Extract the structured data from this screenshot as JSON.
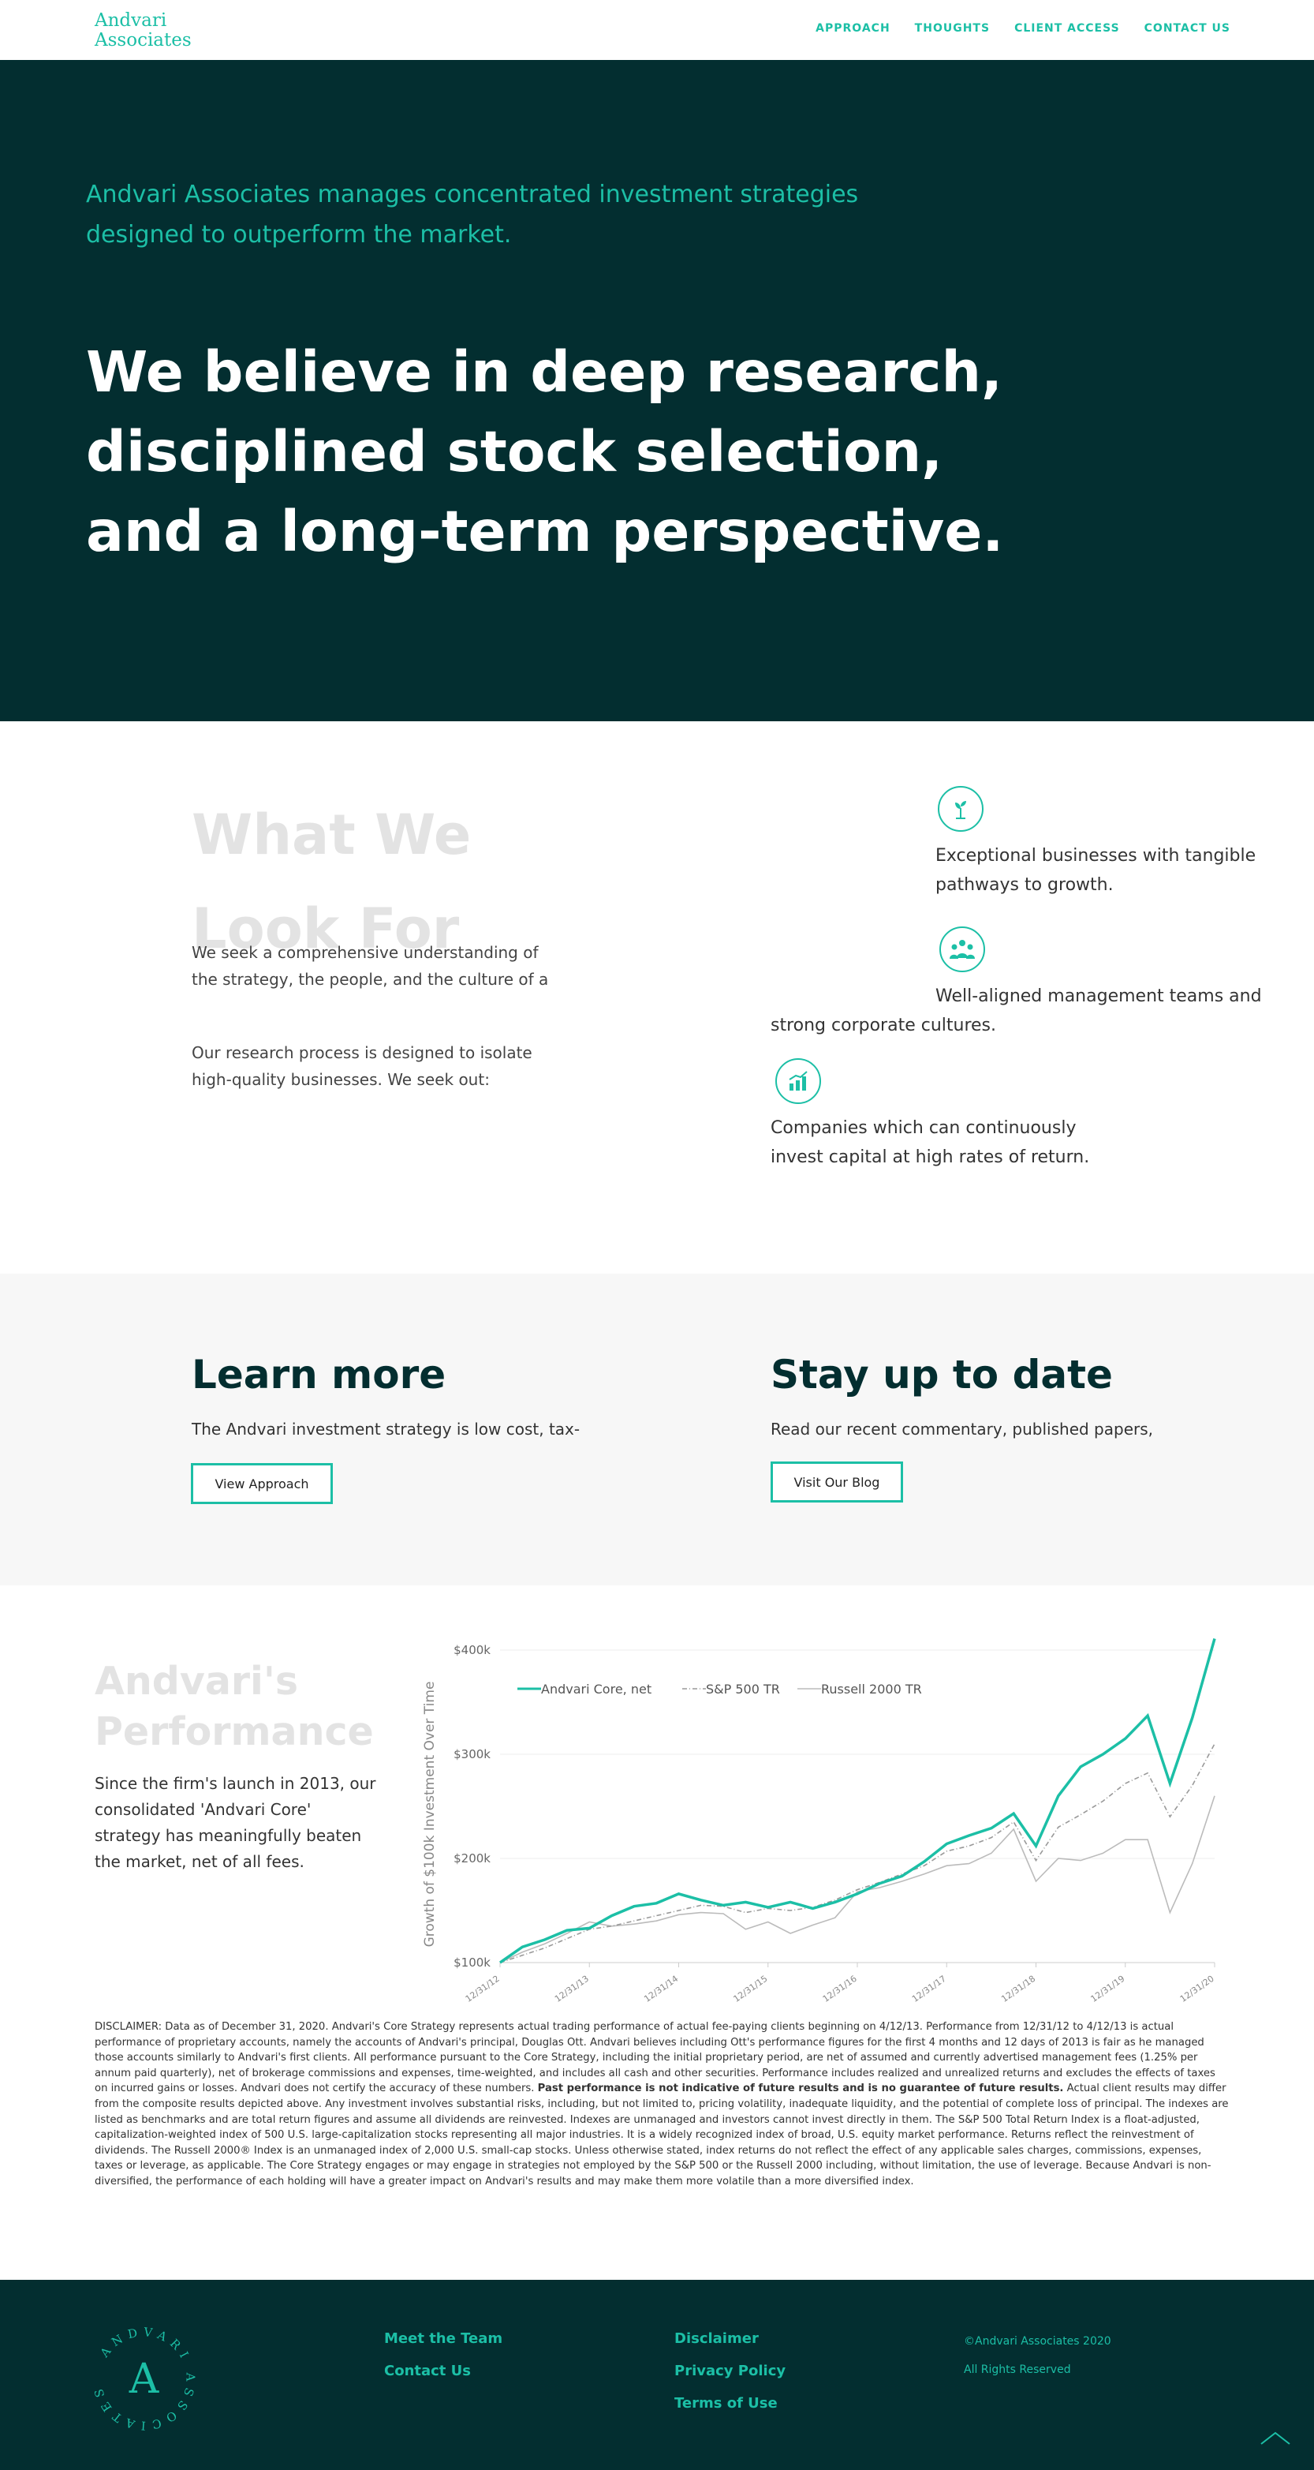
{
  "nav": {
    "logo_line1": "Andvari",
    "logo_line2": "Associates",
    "links": [
      "APPROACH",
      "THOUGHTS",
      "CLIENT ACCESS",
      "CONTACT US"
    ]
  },
  "hero": {
    "lead": "Andvari Associates manages concentrated investment strategies designed to outperform the market.",
    "title": "We believe in deep research, disciplined stock selection, and a long-term perspective."
  },
  "look": {
    "title_line1": "What We",
    "title_line2": "Look For",
    "p1": "We seek a comprehensive understanding of the strategy, the people, and the culture of a business before we invest a penny.",
    "p2": "Our research process is designed to isolate high-quality businesses. We seek out:",
    "features": [
      {
        "icon": "sprout-icon",
        "text": "Exceptional businesses with tangible pathways to growth."
      },
      {
        "icon": "team-icon",
        "text": "Well-aligned management teams and strong corporate cultures."
      },
      {
        "icon": "growth-chart-icon",
        "text": "Companies which can continuously invest capital at high rates of return."
      }
    ]
  },
  "cta": {
    "learn_title": "Learn more",
    "learn_text": "The Andvari investment strategy is low cost, tax-",
    "learn_button": "View Approach",
    "stay_title": "Stay up to date",
    "stay_text": "Read our recent commentary, published papers,",
    "stay_button": "Visit Our Blog"
  },
  "performance": {
    "title_line1": "Andvari's",
    "title_line2": "Performance",
    "text": "Since the firm's launch in 2013, our consolidated 'Andvari Core' strategy has meaningfully beaten the market, net of all fees.",
    "disclaimer_a": "DISCLAIMER: Data as of December 31, 2020. Andvari's Core Strategy represents actual trading performance of actual fee-paying clients beginning on 4/12/13. Performance from 12/31/12 to 4/12/13 is actual performance of proprietary accounts, namely the accounts of Andvari's principal, Douglas Ott. Andvari believes including Ott's performance figures for the first 4 months and 12 days of 2013 is fair as he managed those accounts similarly to Andvari's first clients. All performance pursuant to the Core Strategy, including the initial proprietary period, are net of assumed and currently advertised management fees (1.25% per annum paid quarterly), net of brokerage commissions and expenses, time-weighted, and includes all cash and other securities. Performance includes realized and unrealized returns and excludes the effects of taxes on incurred gains or losses. Andvari does not certify the accuracy of these numbers.",
    "disclaimer_bold": "Past performance is not indicative of future results and is no guarantee of future results.",
    "disclaimer_b": "Actual client results may differ from the composite results depicted above. Any investment involves substantial risks, including, but not limited to, pricing volatility, inadequate liquidity, and the potential of complete loss of principal. The indexes are listed as benchmarks and are total return figures and assume all dividends are reinvested. Indexes are unmanaged and investors cannot invest directly in them. The S&P 500 Total Return Index is a float-adjusted, capitalization-weighted index of 500 U.S. large-capitalization stocks representing all major industries. It is a widely recognized index of broad, U.S. equity market performance. Returns reflect the reinvestment of dividends. The Russell 2000® Index is an unmanaged index of 2,000 U.S. small-cap stocks. Unless otherwise stated, index returns do not reflect the effect of any applicable sales charges, commissions, expenses, taxes or leverage, as applicable. The Core Strategy engages or may engage in strategies not employed by the S&P 500 or the Russell 2000 including, without limitation, the use of leverage. Because Andvari is non-diversified, the performance of each holding will have a greater impact on Andvari's results and may make them more volatile than a more diversified index."
  },
  "chart_data": {
    "type": "line",
    "title": "",
    "xlabel": "",
    "ylabel": "Growth of $100k Investment Over Time",
    "x_ticks": [
      "12/31/12",
      "12/31/13",
      "12/31/14",
      "12/31/15",
      "12/31/16",
      "12/31/17",
      "12/31/18",
      "12/31/19",
      "12/31/20"
    ],
    "y_ticks": [
      "$100k",
      "$200k",
      "$300k",
      "$400k"
    ],
    "ylim": [
      100,
      400
    ],
    "x_units": "years since 12/31/12",
    "xlim": [
      0,
      8
    ],
    "legend_position": "top-left",
    "grid": "horizontal",
    "series": [
      {
        "name": "Andvari Core, net",
        "color": "#1cbfa6",
        "style": "solid",
        "points": [
          [
            0,
            100
          ],
          [
            0.25,
            115
          ],
          [
            0.5,
            122
          ],
          [
            0.75,
            131
          ],
          [
            1,
            133
          ],
          [
            1.25,
            145
          ],
          [
            1.5,
            154
          ],
          [
            1.75,
            157
          ],
          [
            2,
            166
          ],
          [
            2.25,
            160
          ],
          [
            2.5,
            155
          ],
          [
            2.75,
            158
          ],
          [
            3,
            153
          ],
          [
            3.25,
            158
          ],
          [
            3.5,
            152
          ],
          [
            3.75,
            158
          ],
          [
            4,
            166
          ],
          [
            4.25,
            176
          ],
          [
            4.5,
            183
          ],
          [
            4.75,
            197
          ],
          [
            5,
            214
          ],
          [
            5.25,
            222
          ],
          [
            5.5,
            229
          ],
          [
            5.75,
            243
          ],
          [
            6,
            212
          ],
          [
            6.25,
            260
          ],
          [
            6.5,
            288
          ],
          [
            6.75,
            300
          ],
          [
            7,
            315
          ],
          [
            7.25,
            337
          ],
          [
            7.5,
            272
          ],
          [
            7.75,
            335
          ],
          [
            8,
            411
          ]
        ]
      },
      {
        "name": "S&P 500 TR",
        "color": "#999999",
        "style": "dash-dot",
        "points": [
          [
            0,
            100
          ],
          [
            0.25,
            107
          ],
          [
            0.5,
            114
          ],
          [
            0.75,
            123
          ],
          [
            1,
            132
          ],
          [
            1.25,
            135
          ],
          [
            1.5,
            140
          ],
          [
            1.75,
            145
          ],
          [
            2,
            150
          ],
          [
            2.25,
            155
          ],
          [
            2.5,
            154
          ],
          [
            2.75,
            148
          ],
          [
            3,
            152
          ],
          [
            3.25,
            150
          ],
          [
            3.5,
            153
          ],
          [
            3.75,
            160
          ],
          [
            4,
            170
          ],
          [
            4.25,
            177
          ],
          [
            4.5,
            185
          ],
          [
            4.75,
            193
          ],
          [
            5,
            207
          ],
          [
            5.25,
            212
          ],
          [
            5.5,
            220
          ],
          [
            5.75,
            235
          ],
          [
            6,
            198
          ],
          [
            6.25,
            230
          ],
          [
            6.5,
            242
          ],
          [
            6.75,
            255
          ],
          [
            7,
            272
          ],
          [
            7.25,
            282
          ],
          [
            7.5,
            240
          ],
          [
            7.75,
            270
          ],
          [
            8,
            310
          ]
        ]
      },
      {
        "name": "Russell 2000 TR",
        "color": "#bbbbbb",
        "style": "solid",
        "points": [
          [
            0,
            100
          ],
          [
            0.25,
            110
          ],
          [
            0.5,
            118
          ],
          [
            0.75,
            128
          ],
          [
            1,
            139
          ],
          [
            1.25,
            135
          ],
          [
            1.5,
            137
          ],
          [
            1.75,
            140
          ],
          [
            2,
            146
          ],
          [
            2.25,
            148
          ],
          [
            2.5,
            147
          ],
          [
            2.75,
            132
          ],
          [
            3,
            139
          ],
          [
            3.25,
            128
          ],
          [
            3.5,
            136
          ],
          [
            3.75,
            143
          ],
          [
            4,
            168
          ],
          [
            4.25,
            172
          ],
          [
            4.5,
            178
          ],
          [
            4.75,
            185
          ],
          [
            5,
            193
          ],
          [
            5.25,
            195
          ],
          [
            5.5,
            205
          ],
          [
            5.75,
            228
          ],
          [
            6,
            178
          ],
          [
            6.25,
            200
          ],
          [
            6.5,
            198
          ],
          [
            6.75,
            205
          ],
          [
            7,
            218
          ],
          [
            7.25,
            218
          ],
          [
            7.5,
            148
          ],
          [
            7.75,
            195
          ],
          [
            8,
            260
          ]
        ]
      }
    ]
  },
  "footer": {
    "seal_text": "ANDVARI ASSOCIATES",
    "seal_letter": "A",
    "col1": [
      "Meet the Team",
      "Contact Us"
    ],
    "col2": [
      "Disclaimer",
      "Privacy Policy",
      "Terms of Use"
    ],
    "copyright": "©Andvari Associates 2020",
    "rights": "All Rights Reserved"
  }
}
